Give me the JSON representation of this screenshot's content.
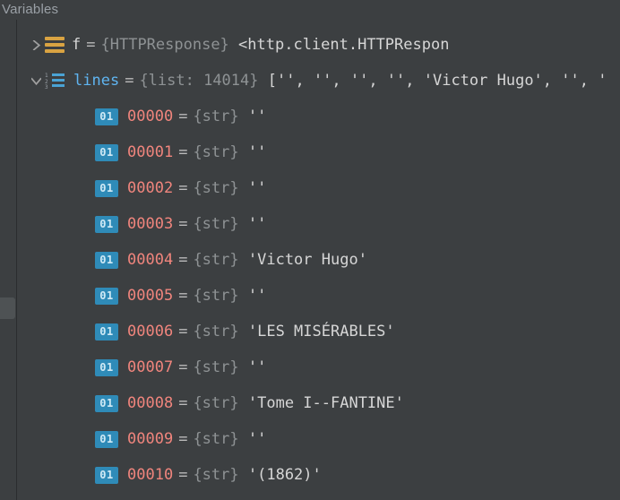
{
  "panel": {
    "title": "Variables"
  },
  "icons": {
    "str_badge": "01"
  },
  "vars": {
    "f": {
      "name": "f",
      "type": "{HTTPResponse}",
      "value": "<http.client.HTTPRespon"
    },
    "lines": {
      "name": "lines",
      "type": "{list: 14014}",
      "value": "['', '', '', '', 'Victor Hugo', '', '",
      "items": [
        {
          "idx": "00000",
          "type": "{str}",
          "value": "''"
        },
        {
          "idx": "00001",
          "type": "{str}",
          "value": "''"
        },
        {
          "idx": "00002",
          "type": "{str}",
          "value": "''"
        },
        {
          "idx": "00003",
          "type": "{str}",
          "value": "''"
        },
        {
          "idx": "00004",
          "type": "{str}",
          "value": "'Victor Hugo'"
        },
        {
          "idx": "00005",
          "type": "{str}",
          "value": "''"
        },
        {
          "idx": "00006",
          "type": "{str}",
          "value": "'LES MISÉRABLES'"
        },
        {
          "idx": "00007",
          "type": "{str}",
          "value": "''"
        },
        {
          "idx": "00008",
          "type": "{str}",
          "value": "'Tome I--FANTINE'"
        },
        {
          "idx": "00009",
          "type": "{str}",
          "value": "''"
        },
        {
          "idx": "00010",
          "type": "{str}",
          "value": "'(1862)'"
        }
      ]
    }
  }
}
